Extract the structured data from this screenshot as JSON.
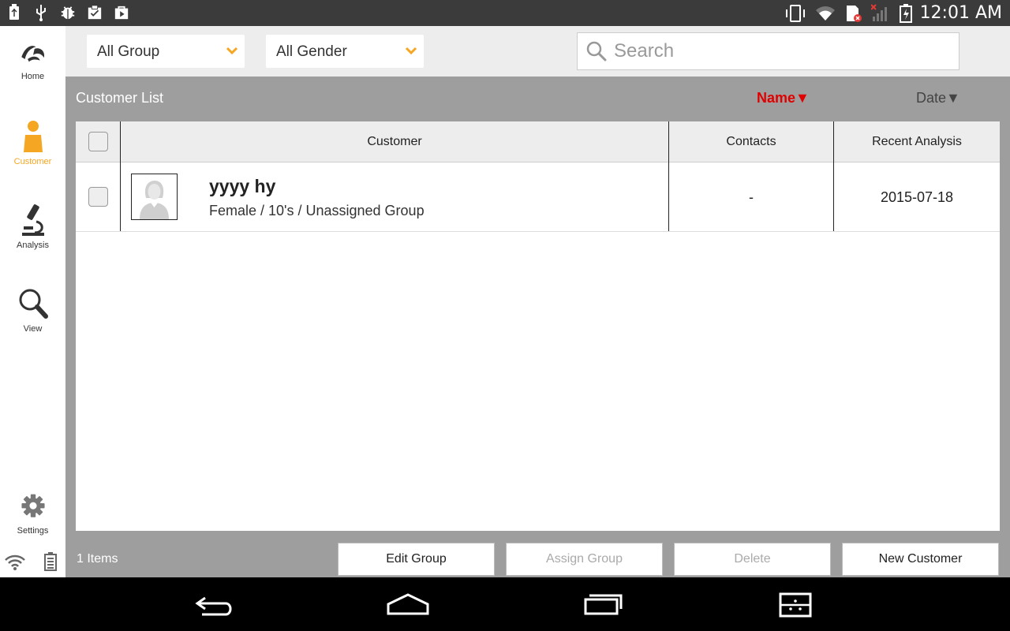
{
  "status_bar": {
    "time": "12:01 AM",
    "icons_left": [
      "usb-icon",
      "usb-debug-icon",
      "android-debug-icon",
      "clipboard-icon",
      "play-store-icon"
    ],
    "icons_right": [
      "vibrate-icon",
      "wifi-icon",
      "sim-error-icon",
      "signal-icon",
      "battery-charging-icon"
    ]
  },
  "sidebar": {
    "items": [
      {
        "label": "Home",
        "icon": "logo-icon",
        "active": false
      },
      {
        "label": "Customer",
        "icon": "person-icon",
        "active": true
      },
      {
        "label": "Analysis",
        "icon": "microscope-icon",
        "active": false
      },
      {
        "label": "View",
        "icon": "magnifier-icon",
        "active": false
      }
    ],
    "settings_label": "Settings",
    "accent_color": "#f5a623"
  },
  "filters": {
    "group": "All Group",
    "gender": "All Gender",
    "search_placeholder": "Search"
  },
  "list": {
    "title": "Customer List",
    "sort_name": "Name▼",
    "sort_date": "Date▼",
    "sort_active_color": "#e00000",
    "columns": [
      "Customer",
      "Contacts",
      "Recent Analysis"
    ],
    "rows": [
      {
        "name": "yyyy hy",
        "details": "Female / 10's / Unassigned Group",
        "contacts": "-",
        "recent_analysis": "2015-07-18"
      }
    ],
    "item_count": "1 Items"
  },
  "actions": {
    "edit_group": "Edit Group",
    "assign_group": "Assign Group",
    "delete": "Delete",
    "new_customer": "New Customer"
  }
}
